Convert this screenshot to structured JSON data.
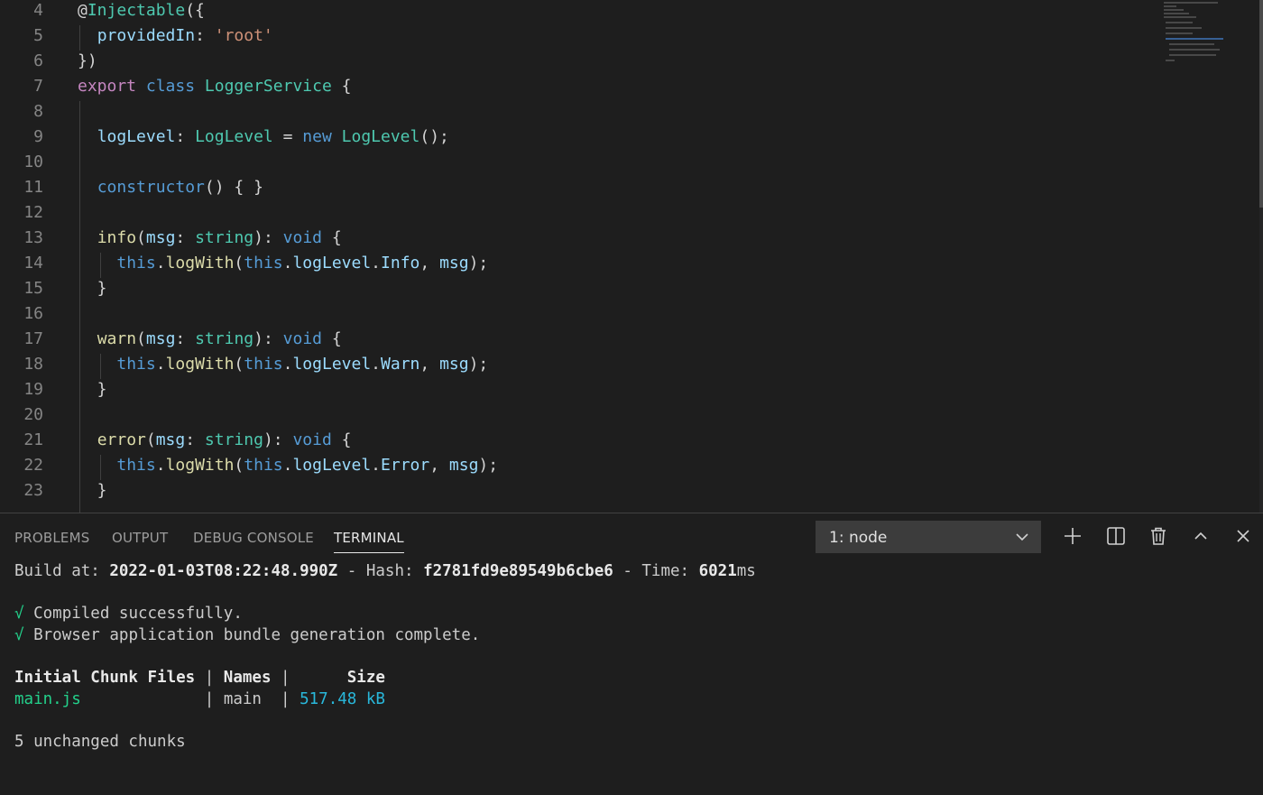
{
  "editor": {
    "lines": [
      {
        "num": "4",
        "tokens": [
          {
            "t": "@",
            "c": "punct"
          },
          {
            "t": "Injectable",
            "c": "type"
          },
          {
            "t": "({",
            "c": "punct"
          }
        ]
      },
      {
        "num": "5",
        "tokens": [
          {
            "t": "  ",
            "c": "punct"
          },
          {
            "t": "providedIn",
            "c": "variable"
          },
          {
            "t": ": ",
            "c": "punct"
          },
          {
            "t": "'root'",
            "c": "string"
          }
        ]
      },
      {
        "num": "6",
        "tokens": [
          {
            "t": "})",
            "c": "punct"
          }
        ]
      },
      {
        "num": "7",
        "tokens": [
          {
            "t": "export",
            "c": "control"
          },
          {
            "t": " ",
            "c": "punct"
          },
          {
            "t": "class",
            "c": "keyword"
          },
          {
            "t": " ",
            "c": "punct"
          },
          {
            "t": "LoggerService",
            "c": "type"
          },
          {
            "t": " {",
            "c": "punct"
          }
        ]
      },
      {
        "num": "8",
        "tokens": []
      },
      {
        "num": "9",
        "tokens": [
          {
            "t": "  ",
            "c": "punct"
          },
          {
            "t": "logLevel",
            "c": "variable"
          },
          {
            "t": ": ",
            "c": "punct"
          },
          {
            "t": "LogLevel",
            "c": "type"
          },
          {
            "t": " = ",
            "c": "punct"
          },
          {
            "t": "new",
            "c": "keyword"
          },
          {
            "t": " ",
            "c": "punct"
          },
          {
            "t": "LogLevel",
            "c": "type"
          },
          {
            "t": "();",
            "c": "punct"
          }
        ]
      },
      {
        "num": "10",
        "tokens": []
      },
      {
        "num": "11",
        "tokens": [
          {
            "t": "  ",
            "c": "punct"
          },
          {
            "t": "constructor",
            "c": "keyword"
          },
          {
            "t": "() { }",
            "c": "punct"
          }
        ]
      },
      {
        "num": "12",
        "tokens": []
      },
      {
        "num": "13",
        "tokens": [
          {
            "t": "  ",
            "c": "punct"
          },
          {
            "t": "info",
            "c": "function"
          },
          {
            "t": "(",
            "c": "punct"
          },
          {
            "t": "msg",
            "c": "variable"
          },
          {
            "t": ": ",
            "c": "punct"
          },
          {
            "t": "string",
            "c": "type"
          },
          {
            "t": "): ",
            "c": "punct"
          },
          {
            "t": "void",
            "c": "keyword"
          },
          {
            "t": " {",
            "c": "punct"
          }
        ]
      },
      {
        "num": "14",
        "tokens": [
          {
            "t": "    ",
            "c": "punct"
          },
          {
            "t": "this",
            "c": "keyword"
          },
          {
            "t": ".",
            "c": "punct"
          },
          {
            "t": "logWith",
            "c": "function"
          },
          {
            "t": "(",
            "c": "punct"
          },
          {
            "t": "this",
            "c": "keyword"
          },
          {
            "t": ".",
            "c": "punct"
          },
          {
            "t": "logLevel",
            "c": "variable"
          },
          {
            "t": ".",
            "c": "punct"
          },
          {
            "t": "Info",
            "c": "variable"
          },
          {
            "t": ", ",
            "c": "punct"
          },
          {
            "t": "msg",
            "c": "variable"
          },
          {
            "t": ");",
            "c": "punct"
          }
        ]
      },
      {
        "num": "15",
        "tokens": [
          {
            "t": "  }",
            "c": "punct"
          }
        ]
      },
      {
        "num": "16",
        "tokens": []
      },
      {
        "num": "17",
        "tokens": [
          {
            "t": "  ",
            "c": "punct"
          },
          {
            "t": "warn",
            "c": "function"
          },
          {
            "t": "(",
            "c": "punct"
          },
          {
            "t": "msg",
            "c": "variable"
          },
          {
            "t": ": ",
            "c": "punct"
          },
          {
            "t": "string",
            "c": "type"
          },
          {
            "t": "): ",
            "c": "punct"
          },
          {
            "t": "void",
            "c": "keyword"
          },
          {
            "t": " {",
            "c": "punct"
          }
        ]
      },
      {
        "num": "18",
        "tokens": [
          {
            "t": "    ",
            "c": "punct"
          },
          {
            "t": "this",
            "c": "keyword"
          },
          {
            "t": ".",
            "c": "punct"
          },
          {
            "t": "logWith",
            "c": "function"
          },
          {
            "t": "(",
            "c": "punct"
          },
          {
            "t": "this",
            "c": "keyword"
          },
          {
            "t": ".",
            "c": "punct"
          },
          {
            "t": "logLevel",
            "c": "variable"
          },
          {
            "t": ".",
            "c": "punct"
          },
          {
            "t": "Warn",
            "c": "variable"
          },
          {
            "t": ", ",
            "c": "punct"
          },
          {
            "t": "msg",
            "c": "variable"
          },
          {
            "t": ");",
            "c": "punct"
          }
        ]
      },
      {
        "num": "19",
        "tokens": [
          {
            "t": "  }",
            "c": "punct"
          }
        ]
      },
      {
        "num": "20",
        "tokens": []
      },
      {
        "num": "21",
        "tokens": [
          {
            "t": "  ",
            "c": "punct"
          },
          {
            "t": "error",
            "c": "function"
          },
          {
            "t": "(",
            "c": "punct"
          },
          {
            "t": "msg",
            "c": "variable"
          },
          {
            "t": ": ",
            "c": "punct"
          },
          {
            "t": "string",
            "c": "type"
          },
          {
            "t": "): ",
            "c": "punct"
          },
          {
            "t": "void",
            "c": "keyword"
          },
          {
            "t": " {",
            "c": "punct"
          }
        ]
      },
      {
        "num": "22",
        "tokens": [
          {
            "t": "    ",
            "c": "punct"
          },
          {
            "t": "this",
            "c": "keyword"
          },
          {
            "t": ".",
            "c": "punct"
          },
          {
            "t": "logWith",
            "c": "function"
          },
          {
            "t": "(",
            "c": "punct"
          },
          {
            "t": "this",
            "c": "keyword"
          },
          {
            "t": ".",
            "c": "punct"
          },
          {
            "t": "logLevel",
            "c": "variable"
          },
          {
            "t": ".",
            "c": "punct"
          },
          {
            "t": "Error",
            "c": "variable"
          },
          {
            "t": ", ",
            "c": "punct"
          },
          {
            "t": "msg",
            "c": "variable"
          },
          {
            "t": ");",
            "c": "punct"
          }
        ]
      },
      {
        "num": "23",
        "tokens": [
          {
            "t": "  }",
            "c": "punct"
          }
        ]
      }
    ]
  },
  "panel": {
    "tabs": [
      {
        "label": "PROBLEMS",
        "active": false
      },
      {
        "label": "OUTPUT",
        "active": false
      },
      {
        "label": "DEBUG CONSOLE",
        "active": false
      },
      {
        "label": "TERMINAL",
        "active": true
      }
    ],
    "terminal_select": {
      "value": "1: node"
    },
    "actions": [
      "plus-icon",
      "split-icon",
      "trash-icon",
      "chevron-up-icon",
      "close-icon"
    ]
  },
  "terminal": {
    "build_prefix": "Build at: ",
    "build_date": "2022-01-03T08:22:48.990Z",
    "hash_prefix": " - Hash: ",
    "hash": "f2781fd9e89549b6cbe6",
    "time_prefix": " - Time: ",
    "time_value": "6021",
    "time_unit": "ms",
    "check_mark": "√",
    "compiled": " Compiled successfully.",
    "bundle": " Browser application bundle generation complete.",
    "table_header_files": "Initial Chunk Files",
    "table_sep": " | ",
    "table_header_names": "Names",
    "table_header_size": "     Size",
    "row_file": "main.js",
    "row_file_pad": "            ",
    "row_name": "main ",
    "row_size": "517.48 kB",
    "unchanged": "5 unchanged chunks"
  }
}
